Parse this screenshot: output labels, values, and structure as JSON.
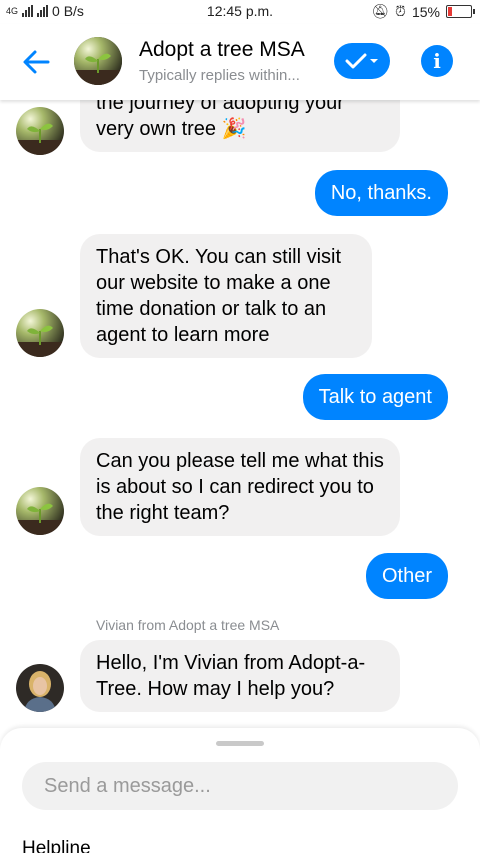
{
  "status_bar": {
    "network": "4G",
    "speed": "0 B/s",
    "time": "12:45 p.m.",
    "battery": "15%",
    "battery_level": 0.15,
    "battery_color": "#e53935"
  },
  "header": {
    "title": "Adopt a tree MSA",
    "subtitle": "Typically replies within...",
    "accent_color": "#0084ff",
    "icons": [
      "back-arrow-icon",
      "check-icon",
      "chevron-down-icon",
      "info-icon"
    ]
  },
  "messages": [
    {
      "side": "in",
      "text": "the journey of adopting your very own tree 🎉"
    },
    {
      "side": "out",
      "text": "No, thanks."
    },
    {
      "side": "in",
      "text": "That's OK. You can still visit our website to make a one time donation or talk to an agent to learn more"
    },
    {
      "side": "out",
      "text": "Talk to agent"
    },
    {
      "side": "in",
      "text": "Can you please tell me what this is about so I can redirect you to the right team?"
    },
    {
      "side": "out",
      "text": "Other"
    },
    {
      "side": "label",
      "text": "Vivian from Adopt a tree MSA"
    },
    {
      "side": "in",
      "text": "Hello, I'm Vivian from Adopt-a-Tree. How may I help you?"
    }
  ],
  "composer": {
    "placeholder": "Send a message..."
  },
  "sheet": {
    "helpline_label": "Helpline"
  }
}
